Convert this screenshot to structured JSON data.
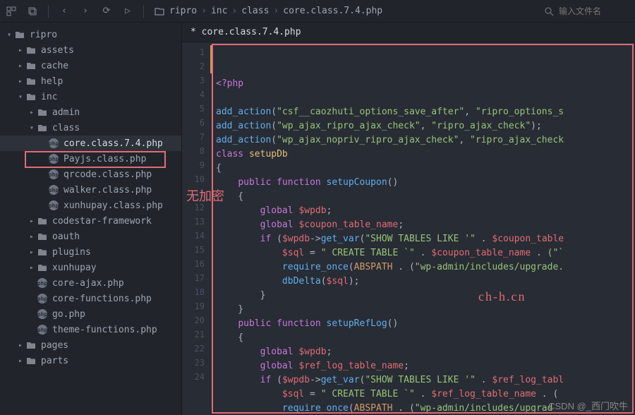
{
  "toolbar": {
    "breadcrumb": [
      "ripro",
      "inc",
      "class",
      "core.class.7.4.php"
    ],
    "search_placeholder": "输入文件名"
  },
  "tab": {
    "label": "* core.class.7.4.php"
  },
  "sidebar": {
    "root": "ripro",
    "items": [
      {
        "label": "assets",
        "type": "folder",
        "depth": 1,
        "arrow": "right"
      },
      {
        "label": "cache",
        "type": "folder",
        "depth": 1,
        "arrow": "right"
      },
      {
        "label": "help",
        "type": "folder",
        "depth": 1,
        "arrow": "right"
      },
      {
        "label": "inc",
        "type": "folder",
        "depth": 1,
        "arrow": "down"
      },
      {
        "label": "admin",
        "type": "folder",
        "depth": 2,
        "arrow": "right"
      },
      {
        "label": "class",
        "type": "folder",
        "depth": 2,
        "arrow": "down"
      },
      {
        "label": "core.class.7.4.php",
        "type": "php",
        "depth": 3,
        "active": true,
        "highlight": true
      },
      {
        "label": "Payjs.class.php",
        "type": "php",
        "depth": 3
      },
      {
        "label": "qrcode.class.php",
        "type": "php",
        "depth": 3
      },
      {
        "label": "walker.class.php",
        "type": "php",
        "depth": 3
      },
      {
        "label": "xunhupay.class.php",
        "type": "php",
        "depth": 3
      },
      {
        "label": "codestar-framework",
        "type": "folder",
        "depth": 2,
        "arrow": "right"
      },
      {
        "label": "oauth",
        "type": "folder",
        "depth": 2,
        "arrow": "right"
      },
      {
        "label": "plugins",
        "type": "folder",
        "depth": 2,
        "arrow": "right"
      },
      {
        "label": "xunhupay",
        "type": "folder",
        "depth": 2,
        "arrow": "right"
      },
      {
        "label": "core-ajax.php",
        "type": "php",
        "depth": 2
      },
      {
        "label": "core-functions.php",
        "type": "php",
        "depth": 2
      },
      {
        "label": "go.php",
        "type": "php",
        "depth": 2
      },
      {
        "label": "theme-functions.php",
        "type": "php",
        "depth": 2
      },
      {
        "label": "pages",
        "type": "folder",
        "depth": 1,
        "arrow": "right"
      },
      {
        "label": "parts",
        "type": "folder",
        "depth": 1,
        "arrow": "right"
      }
    ]
  },
  "code": {
    "first_line": 1,
    "lines": [
      [
        [
          "<?php",
          "kw"
        ]
      ],
      [],
      [
        [
          "add_action",
          "func"
        ],
        [
          "(",
          "punc"
        ],
        [
          "\"csf__caozhuti_options_save_after\"",
          "str"
        ],
        [
          ", ",
          "punc"
        ],
        [
          "\"ripro_options_s",
          "str"
        ]
      ],
      [
        [
          "add_action",
          "func"
        ],
        [
          "(",
          "punc"
        ],
        [
          "\"wp_ajax_ripro_ajax_check\"",
          "str"
        ],
        [
          ", ",
          "punc"
        ],
        [
          "\"ripro_ajax_check\"",
          "str"
        ],
        [
          ");",
          "punc"
        ]
      ],
      [
        [
          "add_action",
          "func"
        ],
        [
          "(",
          "punc"
        ],
        [
          "\"wp_ajax_nopriv_ripro_ajax_check\"",
          "str"
        ],
        [
          ", ",
          "punc"
        ],
        [
          "\"ripro_ajax_check",
          "str"
        ]
      ],
      [
        [
          "class ",
          "kw"
        ],
        [
          "setupDb",
          "cls"
        ]
      ],
      [
        [
          "{",
          "punc"
        ]
      ],
      [
        [
          "    ",
          ""
        ],
        [
          "public function ",
          "kw"
        ],
        [
          "setupCoupon",
          "func"
        ],
        [
          "()",
          "punc"
        ]
      ],
      [
        [
          "    {",
          "punc"
        ]
      ],
      [
        [
          "        ",
          ""
        ],
        [
          "global ",
          "kw"
        ],
        [
          "$wpdb",
          "var"
        ],
        [
          ";",
          "punc"
        ]
      ],
      [
        [
          "        ",
          ""
        ],
        [
          "global ",
          "kw"
        ],
        [
          "$coupon_table_name",
          "var"
        ],
        [
          ";",
          "punc"
        ]
      ],
      [
        [
          "        ",
          ""
        ],
        [
          "if ",
          "kw"
        ],
        [
          "(",
          "punc"
        ],
        [
          "$wpdb",
          "var"
        ],
        [
          "->",
          "op"
        ],
        [
          "get_var",
          "func"
        ],
        [
          "(",
          "punc"
        ],
        [
          "\"SHOW TABLES LIKE '\"",
          "str"
        ],
        [
          " . ",
          "op"
        ],
        [
          "$coupon_table",
          "var"
        ]
      ],
      [
        [
          "            ",
          ""
        ],
        [
          "$sql",
          "var"
        ],
        [
          " = ",
          "op"
        ],
        [
          "\" CREATE TABLE `\"",
          "str"
        ],
        [
          " . ",
          "op"
        ],
        [
          "$coupon_table_name",
          "var"
        ],
        [
          " . ",
          "op"
        ],
        [
          "(\"`",
          "str"
        ]
      ],
      [
        [
          "            ",
          ""
        ],
        [
          "require_once",
          "func"
        ],
        [
          "(",
          "punc"
        ],
        [
          "ABSPATH",
          "const"
        ],
        [
          " . ",
          "op"
        ],
        [
          "(",
          "punc"
        ],
        [
          "\"wp-admin/includes/upgrade.",
          "str"
        ]
      ],
      [
        [
          "            ",
          ""
        ],
        [
          "dbDelta",
          "func"
        ],
        [
          "(",
          "punc"
        ],
        [
          "$sql",
          "var"
        ],
        [
          ");",
          "punc"
        ]
      ],
      [
        [
          "        }",
          "punc"
        ]
      ],
      [
        [
          "    }",
          "punc"
        ]
      ],
      [
        [
          "    ",
          ""
        ],
        [
          "public function ",
          "kw"
        ],
        [
          "setupRefLog",
          "func"
        ],
        [
          "()",
          "punc"
        ]
      ],
      [
        [
          "    {",
          "punc"
        ]
      ],
      [
        [
          "        ",
          ""
        ],
        [
          "global ",
          "kw"
        ],
        [
          "$wpdb",
          "var"
        ],
        [
          ";",
          "punc"
        ]
      ],
      [
        [
          "        ",
          ""
        ],
        [
          "global ",
          "kw"
        ],
        [
          "$ref_log_table_name",
          "var"
        ],
        [
          ";",
          "punc"
        ]
      ],
      [
        [
          "        ",
          ""
        ],
        [
          "if ",
          "kw"
        ],
        [
          "(",
          "punc"
        ],
        [
          "$wpdb",
          "var"
        ],
        [
          "->",
          "op"
        ],
        [
          "get_var",
          "func"
        ],
        [
          "(",
          "punc"
        ],
        [
          "\"SHOW TABLES LIKE '\"",
          "str"
        ],
        [
          " . ",
          "op"
        ],
        [
          "$ref_log_tabl",
          "var"
        ]
      ],
      [
        [
          "            ",
          ""
        ],
        [
          "$sql",
          "var"
        ],
        [
          " = ",
          "op"
        ],
        [
          "\" CREATE TABLE `\"",
          "str"
        ],
        [
          " . ",
          "op"
        ],
        [
          "$ref_log_table_name",
          "var"
        ],
        [
          " . ",
          "op"
        ],
        [
          "(",
          "punc"
        ]
      ],
      [
        [
          "            ",
          ""
        ],
        [
          "require_once",
          "func"
        ],
        [
          "(",
          "punc"
        ],
        [
          "ABSPATH",
          "const"
        ],
        [
          " . ",
          "op"
        ],
        [
          "(",
          "punc"
        ],
        [
          "\"wp-admin/includes/upgrad",
          "str"
        ]
      ]
    ]
  },
  "annotations": {
    "no_encrypt": "无加密",
    "domain": "ch-h.cn",
    "watermark": "CSDN @_西门吹牛"
  }
}
